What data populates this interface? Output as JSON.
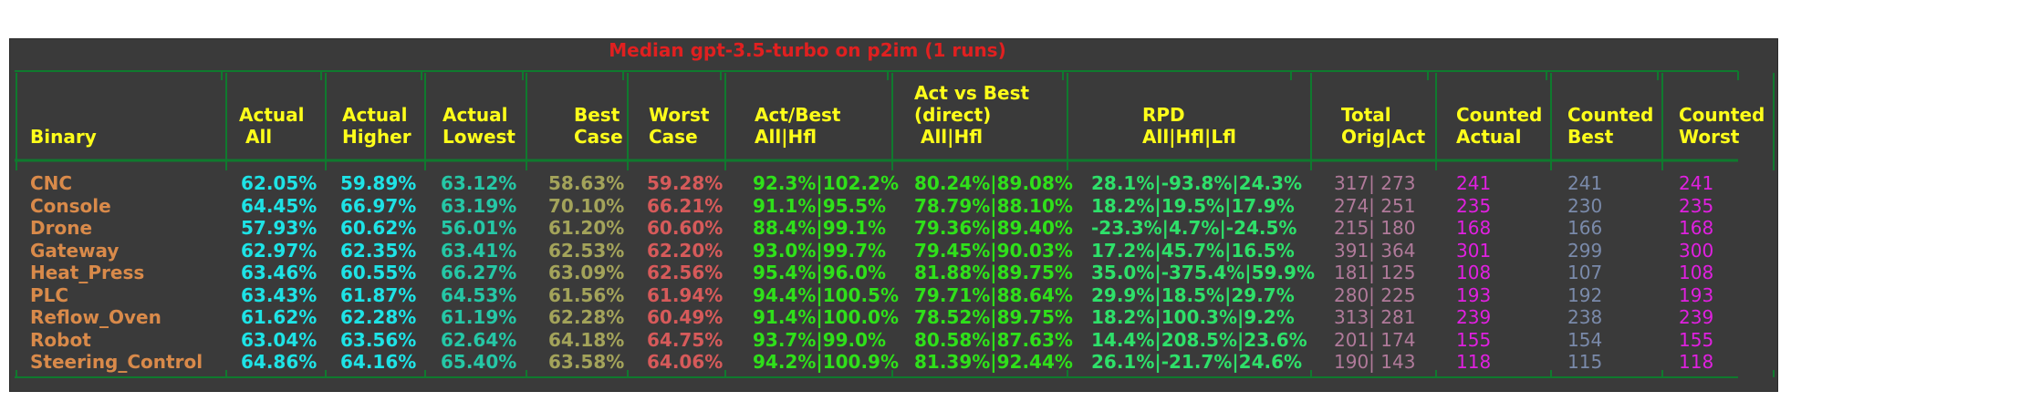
{
  "title": "Median gpt-3.5-turbo on p2im (1 runs)",
  "colors": {
    "panel": "#3a3a3a",
    "grid": "#0f7a2e",
    "title": "#e02020",
    "header": "#ffff1a",
    "binary": "#d98a4a",
    "cyan": "#1ee3e6",
    "teal": "#25c7a6",
    "olive": "#a3a35a",
    "red": "#d65a5a",
    "green": "#2fe01a",
    "mint": "#2ee06a",
    "mauve": "#b07a9a",
    "magenta": "#e020e0",
    "slate": "#7a8aaa"
  },
  "chart_data": {
    "type": "table",
    "title": "Median gpt-3.5-turbo on p2im (1 runs)",
    "columns": [
      {
        "key": "binary",
        "header": "\nBinary"
      },
      {
        "key": "actual_all",
        "header": "Actual\n All"
      },
      {
        "key": "actual_higher",
        "header": "Actual\nHigher"
      },
      {
        "key": "actual_lowest",
        "header": "Actual\nLowest"
      },
      {
        "key": "best_case",
        "header": "Best\nCase"
      },
      {
        "key": "worst_case",
        "header": "Worst\nCase"
      },
      {
        "key": "act_best",
        "header": "Act/Best\nAll|Hfl"
      },
      {
        "key": "act_vs_best",
        "header": "Act vs Best\n(direct)\n All|Hfl"
      },
      {
        "key": "rpd",
        "header": "RPD\nAll|Hfl|Lfl"
      },
      {
        "key": "total",
        "header": "Total\nOrig|Act"
      },
      {
        "key": "counted_actual",
        "header": "Counted\nActual"
      },
      {
        "key": "counted_best",
        "header": "Counted\nBest"
      },
      {
        "key": "counted_worst",
        "header": "Counted\nWorst"
      }
    ],
    "rows": [
      {
        "binary": "CNC",
        "actual_all": "62.05%",
        "actual_higher": "59.89%",
        "actual_lowest": "63.12%",
        "best_case": "58.63%",
        "worst_case": "59.28%",
        "act_best": "92.3%|102.2%",
        "act_vs_best": "80.24%|89.08%",
        "rpd": "28.1%|-93.8%|24.3%",
        "total": "317| 273",
        "counted_actual": "241",
        "counted_best": "241",
        "counted_worst": "241"
      },
      {
        "binary": "Console",
        "actual_all": "64.45%",
        "actual_higher": "66.97%",
        "actual_lowest": "63.19%",
        "best_case": "70.10%",
        "worst_case": "66.21%",
        "act_best": "91.1%|95.5%",
        "act_vs_best": "78.79%|88.10%",
        "rpd": "18.2%|19.5%|17.9%",
        "total": "274| 251",
        "counted_actual": "235",
        "counted_best": "230",
        "counted_worst": "235"
      },
      {
        "binary": "Drone",
        "actual_all": "57.93%",
        "actual_higher": "60.62%",
        "actual_lowest": "56.01%",
        "best_case": "61.20%",
        "worst_case": "60.60%",
        "act_best": "88.4%|99.1%",
        "act_vs_best": "79.36%|89.40%",
        "rpd": "-23.3%|4.7%|-24.5%",
        "total": "215| 180",
        "counted_actual": "168",
        "counted_best": "166",
        "counted_worst": "168"
      },
      {
        "binary": "Gateway",
        "actual_all": "62.97%",
        "actual_higher": "62.35%",
        "actual_lowest": "63.41%",
        "best_case": "62.53%",
        "worst_case": "62.20%",
        "act_best": "93.0%|99.7%",
        "act_vs_best": "79.45%|90.03%",
        "rpd": "17.2%|45.7%|16.5%",
        "total": "391| 364",
        "counted_actual": "301",
        "counted_best": "299",
        "counted_worst": "300"
      },
      {
        "binary": "Heat_Press",
        "actual_all": "63.46%",
        "actual_higher": "60.55%",
        "actual_lowest": "66.27%",
        "best_case": "63.09%",
        "worst_case": "62.56%",
        "act_best": "95.4%|96.0%",
        "act_vs_best": "81.88%|89.75%",
        "rpd": "35.0%|-375.4%|59.9%",
        "total": "181| 125",
        "counted_actual": "108",
        "counted_best": "107",
        "counted_worst": "108"
      },
      {
        "binary": "PLC",
        "actual_all": "63.43%",
        "actual_higher": "61.87%",
        "actual_lowest": "64.53%",
        "best_case": "61.56%",
        "worst_case": "61.94%",
        "act_best": "94.4%|100.5%",
        "act_vs_best": "79.71%|88.64%",
        "rpd": "29.9%|18.5%|29.7%",
        "total": "280| 225",
        "counted_actual": "193",
        "counted_best": "192",
        "counted_worst": "193"
      },
      {
        "binary": "Reflow_Oven",
        "actual_all": "61.62%",
        "actual_higher": "62.28%",
        "actual_lowest": "61.19%",
        "best_case": "62.28%",
        "worst_case": "60.49%",
        "act_best": "91.4%|100.0%",
        "act_vs_best": "78.52%|89.75%",
        "rpd": "18.2%|100.3%|9.2%",
        "total": "313| 281",
        "counted_actual": "239",
        "counted_best": "238",
        "counted_worst": "239"
      },
      {
        "binary": "Robot",
        "actual_all": "63.04%",
        "actual_higher": "63.56%",
        "actual_lowest": "62.64%",
        "best_case": "64.18%",
        "worst_case": "64.75%",
        "act_best": "93.7%|99.0%",
        "act_vs_best": "80.58%|87.63%",
        "rpd": "14.4%|208.5%|23.6%",
        "total": "201| 174",
        "counted_actual": "155",
        "counted_best": "154",
        "counted_worst": "155"
      },
      {
        "binary": "Steering_Control",
        "actual_all": "64.86%",
        "actual_higher": "64.16%",
        "actual_lowest": "65.40%",
        "best_case": "63.58%",
        "worst_case": "64.06%",
        "act_best": "94.2%|100.9%",
        "act_vs_best": "81.39%|92.44%",
        "rpd": "26.1%|-21.7%|24.6%",
        "total": "190| 143",
        "counted_actual": "118",
        "counted_best": "115",
        "counted_worst": "118"
      }
    ]
  }
}
